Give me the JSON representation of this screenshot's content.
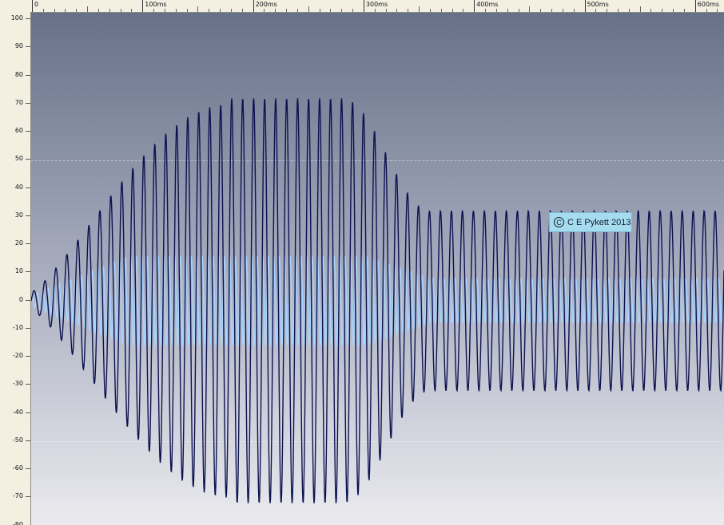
{
  "ruler_top": {
    "labels": [
      "0",
      "100ms",
      "200ms",
      "300ms",
      "400ms",
      "500ms",
      "600ms"
    ]
  },
  "ruler_left": {
    "labels": [
      "100",
      "90",
      "80",
      "70",
      "60",
      "50",
      "40",
      "30",
      "20",
      "10",
      "0",
      "-10",
      "-20",
      "-30",
      "-40",
      "-50",
      "-60",
      "-70",
      "-80"
    ]
  },
  "copyright": {
    "symbol": "C",
    "text": "C E Pykett 2013"
  },
  "colors": {
    "wave_dark": "#0c1250",
    "wave_light": "#a8d6ff",
    "plot_top": "#667188",
    "plot_bottom": "#ebebef",
    "ruler_bg": "#f3f0e2",
    "label_bg": "#a5dcf0"
  }
}
